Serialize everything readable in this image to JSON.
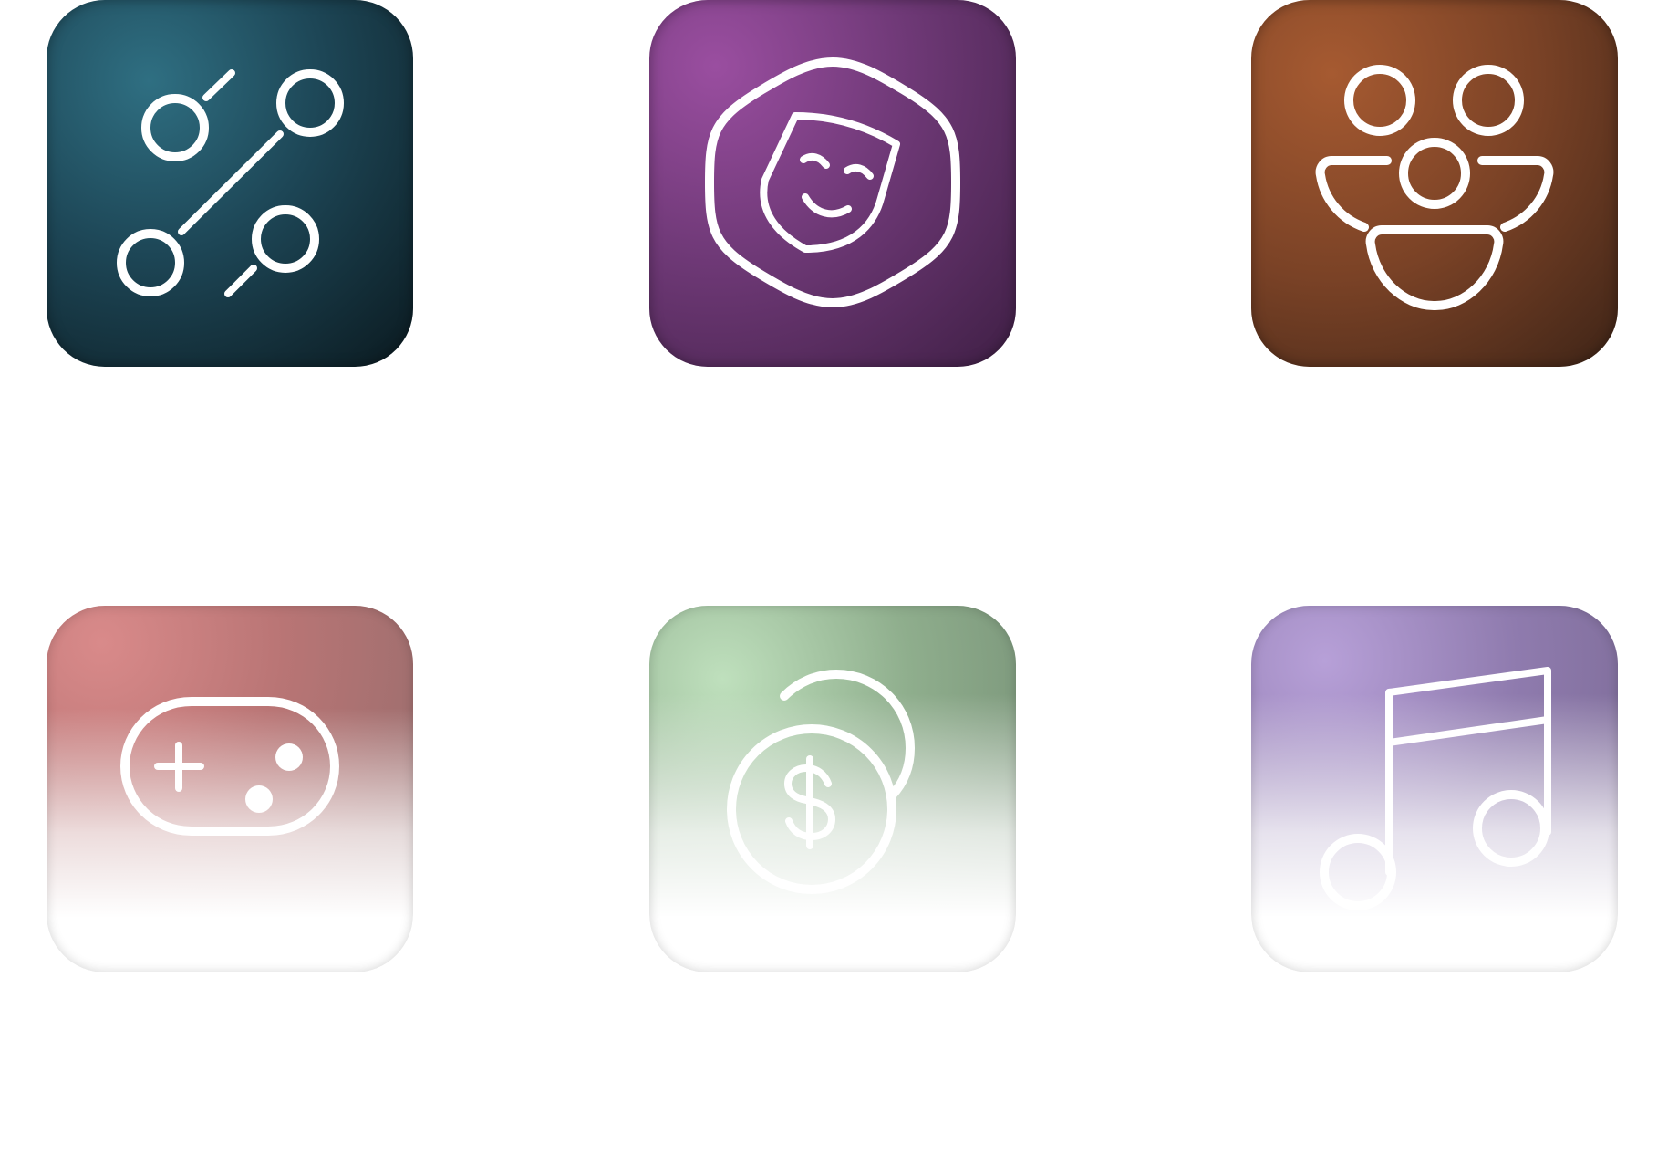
{
  "icons": [
    {
      "name": "percent-icon",
      "background": "#1d4656"
    },
    {
      "name": "theater-mask-icon",
      "background": "#6f3977"
    },
    {
      "name": "people-group-icon",
      "background": "#7a4226"
    },
    {
      "name": "gamepad-icon",
      "background": "#b97575"
    },
    {
      "name": "coins-dollar-icon",
      "background": "#8fae8d"
    },
    {
      "name": "music-note-icon",
      "background": "#8f7bae"
    }
  ],
  "colors": {
    "glyph": "#ffffff",
    "page_background": "#ffffff"
  }
}
